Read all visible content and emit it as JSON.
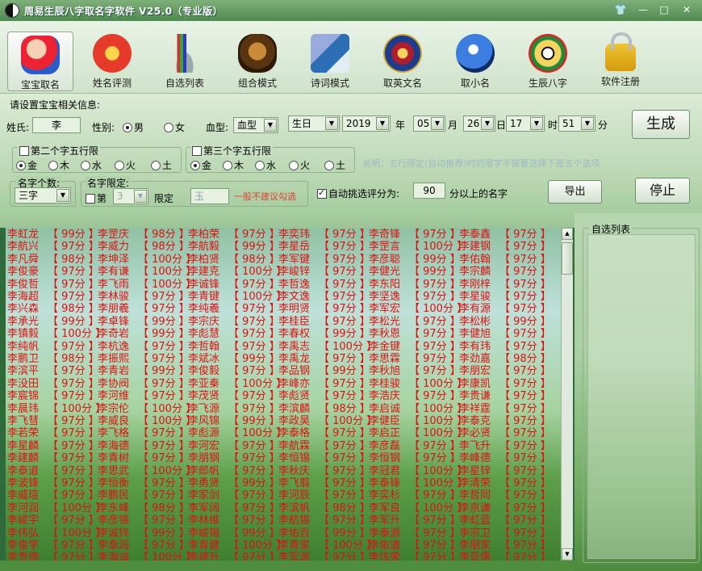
{
  "window": {
    "title": "周易生辰八字取名字软件 V25.0（专业版）",
    "skin_icon": "tshirt-icon",
    "min_label": "—",
    "max_label": "□",
    "close_label": "✕"
  },
  "toolbar": {
    "items": [
      {
        "label": "宝宝取名",
        "icon": "baby-icon"
      },
      {
        "label": "姓名评测",
        "icon": "lantern-icon"
      },
      {
        "label": "自选列表",
        "icon": "brush-holder-icon"
      },
      {
        "label": "组合模式",
        "icon": "lion-icon"
      },
      {
        "label": "诗词模式",
        "icon": "book-cd-icon"
      },
      {
        "label": "取英文名",
        "icon": "club-badge-icon"
      },
      {
        "label": "取小名",
        "icon": "globe-bird-icon"
      },
      {
        "label": "生辰八字",
        "icon": "bagua-icon"
      },
      {
        "label": "软件注册",
        "icon": "lock-icon"
      }
    ]
  },
  "settings": {
    "section_label": "请设置宝宝相关信息:",
    "surname_label": "姓氏:",
    "surname_value": "李",
    "gender_label": "性别:",
    "male_label": "男",
    "female_label": "女",
    "blood_label": "血型:",
    "blood_value": "血型",
    "birthday_type": "生日",
    "year": "2019",
    "year_unit": "年",
    "month": "05",
    "month_unit": "月",
    "day": "26",
    "day_unit": "日",
    "hour": "17",
    "hour_unit": "时",
    "minute": "51",
    "minute_unit": "分",
    "generate_label": "生成",
    "second_wuxing_label": "第二个字五行限",
    "third_wuxing_label": "第三个字五行限",
    "wuxing": [
      "金",
      "木",
      "水",
      "火",
      "土"
    ],
    "note": "说明：五行限定(自动推荐)时的限字不需要选择下面五个选项",
    "count_group_label": "名字个数:",
    "count_value": "三字",
    "limit_group_label": "名字限定:",
    "limit_first_label": "第",
    "limit_pos_value": "3",
    "limit_label": "限定",
    "limit_char_value": "玉",
    "limit_hint": "一般不建议勾选",
    "auto_filter_label": "自动挑选评分为:",
    "auto_filter_value": "90",
    "auto_filter_suffix": "分以上的名字",
    "export_label": "导出",
    "stop_label": "停止"
  },
  "custom_list": {
    "title": "自选列表"
  },
  "names": [
    [
      "李虹龙",
      "99分"
    ],
    [
      "李罡庆",
      "98分"
    ],
    [
      "李柏荣",
      "97分"
    ],
    [
      "李奕玮",
      "97分"
    ],
    [
      "李奇锋",
      "97分"
    ],
    [
      "李泰鑫",
      "97分"
    ],
    [
      "李航兴",
      "97分"
    ],
    [
      "李威力",
      "98分"
    ],
    [
      "李航毅",
      "99分"
    ],
    [
      "李星岳",
      "97分"
    ],
    [
      "李罡言",
      "100分"
    ],
    [
      "李建钢",
      "97分"
    ],
    [
      "李凡舜",
      "98分"
    ],
    [
      "李坤泽",
      "100分"
    ],
    [
      "李柏贤",
      "98分"
    ],
    [
      "李军键",
      "97分"
    ],
    [
      "李彦聪",
      "99分"
    ],
    [
      "李佑翰",
      "97分"
    ],
    [
      "李俊豪",
      "97分"
    ],
    [
      "李有谦",
      "100分"
    ],
    [
      "李建克",
      "100分"
    ],
    [
      "李峻锌",
      "97分"
    ],
    [
      "李健光",
      "99分"
    ],
    [
      "李宗麟",
      "97分"
    ],
    [
      "李俊哲",
      "97分"
    ],
    [
      "李飞雨",
      "100分"
    ],
    [
      "李诚锋",
      "97分"
    ],
    [
      "李哲逸",
      "97分"
    ],
    [
      "李东阳",
      "97分"
    ],
    [
      "李刚梓",
      "97分"
    ],
    [
      "李海超",
      "97分"
    ],
    [
      "李林骏",
      "97分"
    ],
    [
      "李青键",
      "100分"
    ],
    [
      "李文逸",
      "97分"
    ],
    [
      "李坚逸",
      "97分"
    ],
    [
      "李星骏",
      "97分"
    ],
    [
      "李兴森",
      "98分"
    ],
    [
      "李朋羲",
      "97分"
    ],
    [
      "李纯羲",
      "97分"
    ],
    [
      "李明贤",
      "97分"
    ],
    [
      "李军宏",
      "100分"
    ],
    [
      "李有源",
      "97分"
    ],
    [
      "李承光",
      "99分"
    ],
    [
      "李卓锋",
      "99分"
    ],
    [
      "李宗庆",
      "97分"
    ],
    [
      "李桂臣",
      "97分"
    ],
    [
      "李松光",
      "97分"
    ],
    [
      "李松彬",
      "99分"
    ],
    [
      "李镇毅",
      "100分"
    ],
    [
      "李奇岩",
      "99分"
    ],
    [
      "李彪慧",
      "97分"
    ],
    [
      "李春权",
      "99分"
    ],
    [
      "李秋恩",
      "97分"
    ],
    [
      "李健旭",
      "97分"
    ],
    [
      "李纯帆",
      "97分"
    ],
    [
      "李杭逸",
      "97分"
    ],
    [
      "李哲翰",
      "97分"
    ],
    [
      "李禹志",
      "100分"
    ],
    [
      "李金键",
      "97分"
    ],
    [
      "李有玮",
      "97分"
    ],
    [
      "李鹏卫",
      "98分"
    ],
    [
      "李振熙",
      "97分"
    ],
    [
      "李斌冰",
      "99分"
    ],
    [
      "李禹龙",
      "97分"
    ],
    [
      "李思霖",
      "97分"
    ],
    [
      "李劲嘉",
      "98分"
    ],
    [
      "李滨平",
      "97分"
    ],
    [
      "李青岩",
      "99分"
    ],
    [
      "李俊毅",
      "97分"
    ],
    [
      "李品钢",
      "99分"
    ],
    [
      "李秋旭",
      "97分"
    ],
    [
      "李朋宏",
      "97分"
    ],
    [
      "李没田",
      "97分"
    ],
    [
      "李协阀",
      "97分"
    ],
    [
      "李亚秦",
      "100分"
    ],
    [
      "李峰亦",
      "97分"
    ],
    [
      "李桂骏",
      "100分"
    ],
    [
      "李康凯",
      "97分"
    ],
    [
      "李宸锦",
      "97分"
    ],
    [
      "李河维",
      "97分"
    ],
    [
      "李茂贤",
      "97分"
    ],
    [
      "李彪贤",
      "97分"
    ],
    [
      "李浩庆",
      "97分"
    ],
    [
      "李贵谦",
      "97分"
    ],
    [
      "李晨玮",
      "100分"
    ],
    [
      "李宗伦",
      "100分"
    ],
    [
      "李飞源",
      "97分"
    ],
    [
      "李滨麟",
      "98分"
    ],
    [
      "李启诚",
      "100分"
    ],
    [
      "李祥霆",
      "97分"
    ],
    [
      "李飞彗",
      "97分"
    ],
    [
      "李威良",
      "100分"
    ],
    [
      "李风锦",
      "99分"
    ],
    [
      "李政昊",
      "100分"
    ],
    [
      "李健臣",
      "100分"
    ],
    [
      "李泰克",
      "97分"
    ],
    [
      "李若荣",
      "97分"
    ],
    [
      "李飞格",
      "97分"
    ],
    [
      "李彪源",
      "100分"
    ],
    [
      "李泰格",
      "97分"
    ],
    [
      "李启正",
      "100分"
    ],
    [
      "李必贤",
      "97分"
    ],
    [
      "李星麟",
      "97分"
    ],
    [
      "李海德",
      "97分"
    ],
    [
      "李河宏",
      "97分"
    ],
    [
      "李航霖",
      "97分"
    ],
    [
      "李彦磊",
      "97分"
    ],
    [
      "李飞升",
      "97分"
    ],
    [
      "李建麟",
      "97分"
    ],
    [
      "李青树",
      "97分"
    ],
    [
      "李朋钢",
      "97分"
    ],
    [
      "李恒锡",
      "97分"
    ],
    [
      "李恒钢",
      "97分"
    ],
    [
      "李峰德",
      "97分"
    ],
    [
      "李泰道",
      "97分"
    ],
    [
      "李思武",
      "100分"
    ],
    [
      "李郎帆",
      "97分"
    ],
    [
      "李秋庆",
      "97分"
    ],
    [
      "李冠君",
      "100分"
    ],
    [
      "李星锌",
      "97分"
    ],
    [
      "李波锋",
      "97分"
    ],
    [
      "李恒衡",
      "97分"
    ],
    [
      "李勇贤",
      "99分"
    ],
    [
      "李飞翦",
      "97分"
    ],
    [
      "李泰锋",
      "100分"
    ],
    [
      "李清荣",
      "97分"
    ],
    [
      "李威瑄",
      "97分"
    ],
    [
      "李鹏民",
      "97分"
    ],
    [
      "李家剑",
      "97分"
    ],
    [
      "李河辰",
      "97分"
    ],
    [
      "李奕杉",
      "97分"
    ],
    [
      "李哲同",
      "97分"
    ],
    [
      "李河润",
      "100分"
    ],
    [
      "李东峰",
      "98分"
    ],
    [
      "李军阔",
      "97分"
    ],
    [
      "李滨帆",
      "98分"
    ],
    [
      "李军良",
      "100分"
    ],
    [
      "李京谦",
      "97分"
    ],
    [
      "李峻宇",
      "97分"
    ],
    [
      "李彦锡",
      "97分"
    ],
    [
      "李林维",
      "97分"
    ],
    [
      "李航锡",
      "97分"
    ],
    [
      "李军升",
      "97分"
    ],
    [
      "李虹蓝",
      "97分"
    ],
    [
      "李伟弘",
      "100分"
    ],
    [
      "李诚锌",
      "99分"
    ],
    [
      "李峻锡",
      "99分"
    ],
    [
      "李佑百",
      "99分"
    ],
    [
      "李泰源",
      "97分"
    ],
    [
      "李宗卫",
      "97分"
    ],
    [
      "李俊学",
      "97分"
    ],
    [
      "李泰润",
      "97分"
    ],
    [
      "李青健",
      "100分"
    ],
    [
      "李青家",
      "100分"
    ],
    [
      "李佑道",
      "97分"
    ],
    [
      "李朋家",
      "97分"
    ],
    [
      "李贵德",
      "97分"
    ],
    [
      "李海诚",
      "100分"
    ],
    [
      "李建升",
      "97分"
    ],
    [
      "李军源",
      "97分"
    ],
    [
      "李炫荣",
      "97分"
    ],
    [
      "李亚儒",
      "97分"
    ],
    [
      "李祥议",
      "97分"
    ],
    [
      "李浩伊",
      "97分"
    ],
    [
      "李星帅",
      "97分"
    ],
    [
      "李伦伊",
      "97分"
    ],
    [
      "李基栩",
      "97分"
    ],
    [
      "李泰材",
      "97分"
    ]
  ]
}
